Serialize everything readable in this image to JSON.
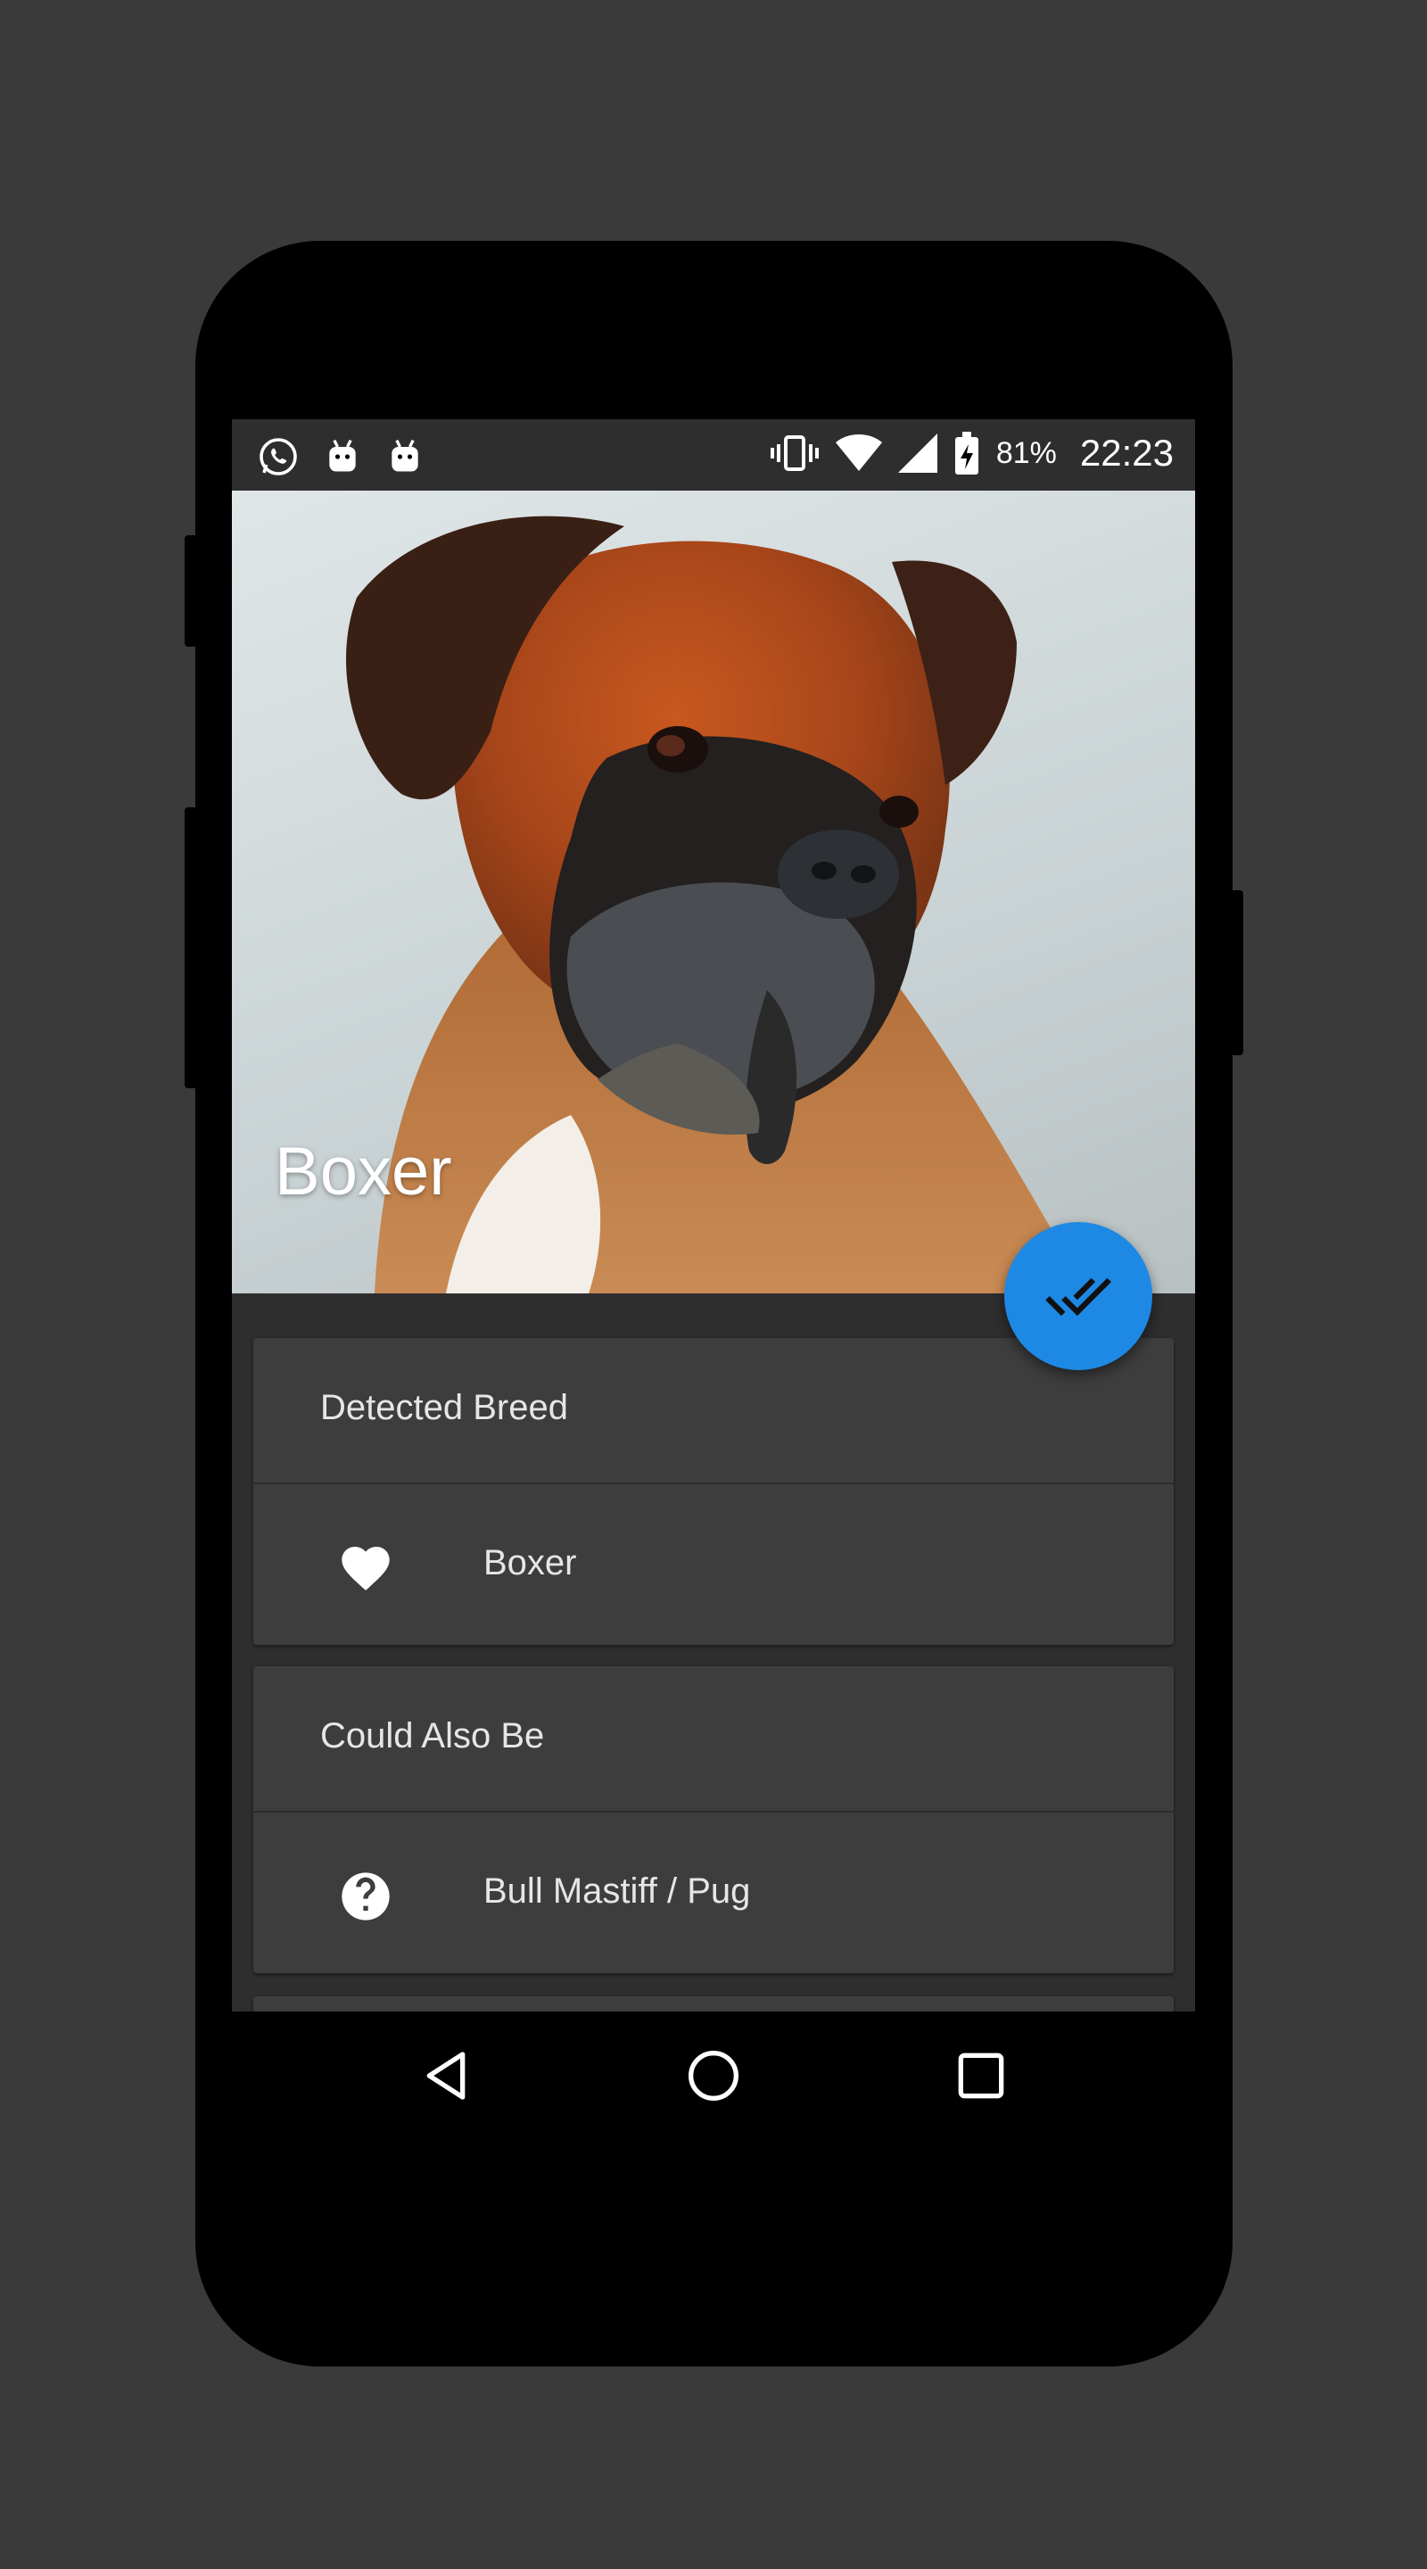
{
  "status_bar": {
    "notification_icons": [
      "whatsapp-icon",
      "android-icon",
      "android-icon"
    ],
    "system_icons": [
      "vibrate-icon",
      "wifi-icon",
      "cell-signal-icon",
      "battery-charging-icon"
    ],
    "battery_percent": "81%",
    "time": "22:23"
  },
  "hero": {
    "title": "Boxer",
    "image_subject": "boxer-dog-photo"
  },
  "fab": {
    "icon": "double-check-icon",
    "color": "#1e88e5"
  },
  "cards": [
    {
      "header": "Detected Breed",
      "row": {
        "icon": "heart-icon",
        "label": "Boxer"
      }
    },
    {
      "header": "Could Also Be",
      "row": {
        "icon": "help-circle-icon",
        "label": "Bull Mastiff / Pug"
      }
    }
  ],
  "nav_bar": {
    "buttons": [
      "back-icon",
      "home-icon",
      "recents-icon"
    ]
  },
  "colors": {
    "background": "#3a3a3a",
    "screen_background": "#2e2e2e",
    "card": "#3d3d3d",
    "accent": "#1e88e5"
  }
}
